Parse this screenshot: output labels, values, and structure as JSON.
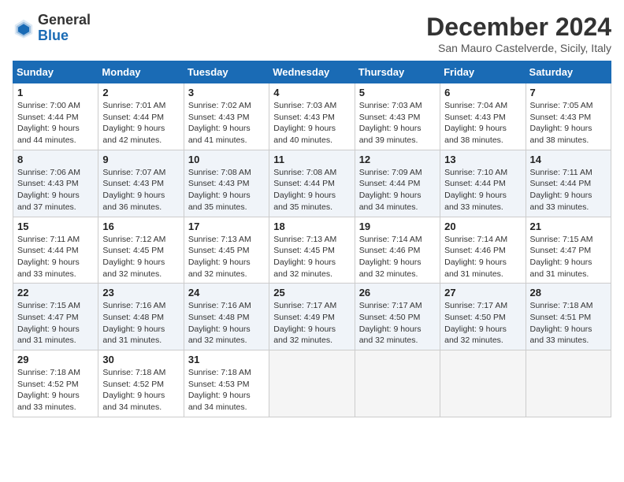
{
  "header": {
    "logo_general": "General",
    "logo_blue": "Blue",
    "month_title": "December 2024",
    "location": "San Mauro Castelverde, Sicily, Italy"
  },
  "calendar": {
    "days_of_week": [
      "Sunday",
      "Monday",
      "Tuesday",
      "Wednesday",
      "Thursday",
      "Friday",
      "Saturday"
    ],
    "weeks": [
      [
        {
          "day": "",
          "empty": true
        },
        {
          "day": "",
          "empty": true
        },
        {
          "day": "",
          "empty": true
        },
        {
          "day": "",
          "empty": true
        },
        {
          "day": "",
          "empty": true
        },
        {
          "day": "",
          "empty": true
        },
        {
          "day": "",
          "empty": true
        }
      ],
      [
        {
          "day": "1",
          "sunrise": "7:00 AM",
          "sunset": "4:44 PM",
          "daylight": "9 hours and 44 minutes."
        },
        {
          "day": "2",
          "sunrise": "7:01 AM",
          "sunset": "4:44 PM",
          "daylight": "9 hours and 42 minutes."
        },
        {
          "day": "3",
          "sunrise": "7:02 AM",
          "sunset": "4:43 PM",
          "daylight": "9 hours and 41 minutes."
        },
        {
          "day": "4",
          "sunrise": "7:03 AM",
          "sunset": "4:43 PM",
          "daylight": "9 hours and 40 minutes."
        },
        {
          "day": "5",
          "sunrise": "7:03 AM",
          "sunset": "4:43 PM",
          "daylight": "9 hours and 39 minutes."
        },
        {
          "day": "6",
          "sunrise": "7:04 AM",
          "sunset": "4:43 PM",
          "daylight": "9 hours and 38 minutes."
        },
        {
          "day": "7",
          "sunrise": "7:05 AM",
          "sunset": "4:43 PM",
          "daylight": "9 hours and 38 minutes."
        }
      ],
      [
        {
          "day": "8",
          "sunrise": "7:06 AM",
          "sunset": "4:43 PM",
          "daylight": "9 hours and 37 minutes."
        },
        {
          "day": "9",
          "sunrise": "7:07 AM",
          "sunset": "4:43 PM",
          "daylight": "9 hours and 36 minutes."
        },
        {
          "day": "10",
          "sunrise": "7:08 AM",
          "sunset": "4:43 PM",
          "daylight": "9 hours and 35 minutes."
        },
        {
          "day": "11",
          "sunrise": "7:08 AM",
          "sunset": "4:44 PM",
          "daylight": "9 hours and 35 minutes."
        },
        {
          "day": "12",
          "sunrise": "7:09 AM",
          "sunset": "4:44 PM",
          "daylight": "9 hours and 34 minutes."
        },
        {
          "day": "13",
          "sunrise": "7:10 AM",
          "sunset": "4:44 PM",
          "daylight": "9 hours and 33 minutes."
        },
        {
          "day": "14",
          "sunrise": "7:11 AM",
          "sunset": "4:44 PM",
          "daylight": "9 hours and 33 minutes."
        }
      ],
      [
        {
          "day": "15",
          "sunrise": "7:11 AM",
          "sunset": "4:44 PM",
          "daylight": "9 hours and 33 minutes."
        },
        {
          "day": "16",
          "sunrise": "7:12 AM",
          "sunset": "4:45 PM",
          "daylight": "9 hours and 32 minutes."
        },
        {
          "day": "17",
          "sunrise": "7:13 AM",
          "sunset": "4:45 PM",
          "daylight": "9 hours and 32 minutes."
        },
        {
          "day": "18",
          "sunrise": "7:13 AM",
          "sunset": "4:45 PM",
          "daylight": "9 hours and 32 minutes."
        },
        {
          "day": "19",
          "sunrise": "7:14 AM",
          "sunset": "4:46 PM",
          "daylight": "9 hours and 32 minutes."
        },
        {
          "day": "20",
          "sunrise": "7:14 AM",
          "sunset": "4:46 PM",
          "daylight": "9 hours and 31 minutes."
        },
        {
          "day": "21",
          "sunrise": "7:15 AM",
          "sunset": "4:47 PM",
          "daylight": "9 hours and 31 minutes."
        }
      ],
      [
        {
          "day": "22",
          "sunrise": "7:15 AM",
          "sunset": "4:47 PM",
          "daylight": "9 hours and 31 minutes."
        },
        {
          "day": "23",
          "sunrise": "7:16 AM",
          "sunset": "4:48 PM",
          "daylight": "9 hours and 31 minutes."
        },
        {
          "day": "24",
          "sunrise": "7:16 AM",
          "sunset": "4:48 PM",
          "daylight": "9 hours and 32 minutes."
        },
        {
          "day": "25",
          "sunrise": "7:17 AM",
          "sunset": "4:49 PM",
          "daylight": "9 hours and 32 minutes."
        },
        {
          "day": "26",
          "sunrise": "7:17 AM",
          "sunset": "4:50 PM",
          "daylight": "9 hours and 32 minutes."
        },
        {
          "day": "27",
          "sunrise": "7:17 AM",
          "sunset": "4:50 PM",
          "daylight": "9 hours and 32 minutes."
        },
        {
          "day": "28",
          "sunrise": "7:18 AM",
          "sunset": "4:51 PM",
          "daylight": "9 hours and 33 minutes."
        }
      ],
      [
        {
          "day": "29",
          "sunrise": "7:18 AM",
          "sunset": "4:52 PM",
          "daylight": "9 hours and 33 minutes."
        },
        {
          "day": "30",
          "sunrise": "7:18 AM",
          "sunset": "4:52 PM",
          "daylight": "9 hours and 34 minutes."
        },
        {
          "day": "31",
          "sunrise": "7:18 AM",
          "sunset": "4:53 PM",
          "daylight": "9 hours and 34 minutes."
        },
        {
          "day": "",
          "empty": true
        },
        {
          "day": "",
          "empty": true
        },
        {
          "day": "",
          "empty": true
        },
        {
          "day": "",
          "empty": true
        }
      ]
    ]
  }
}
